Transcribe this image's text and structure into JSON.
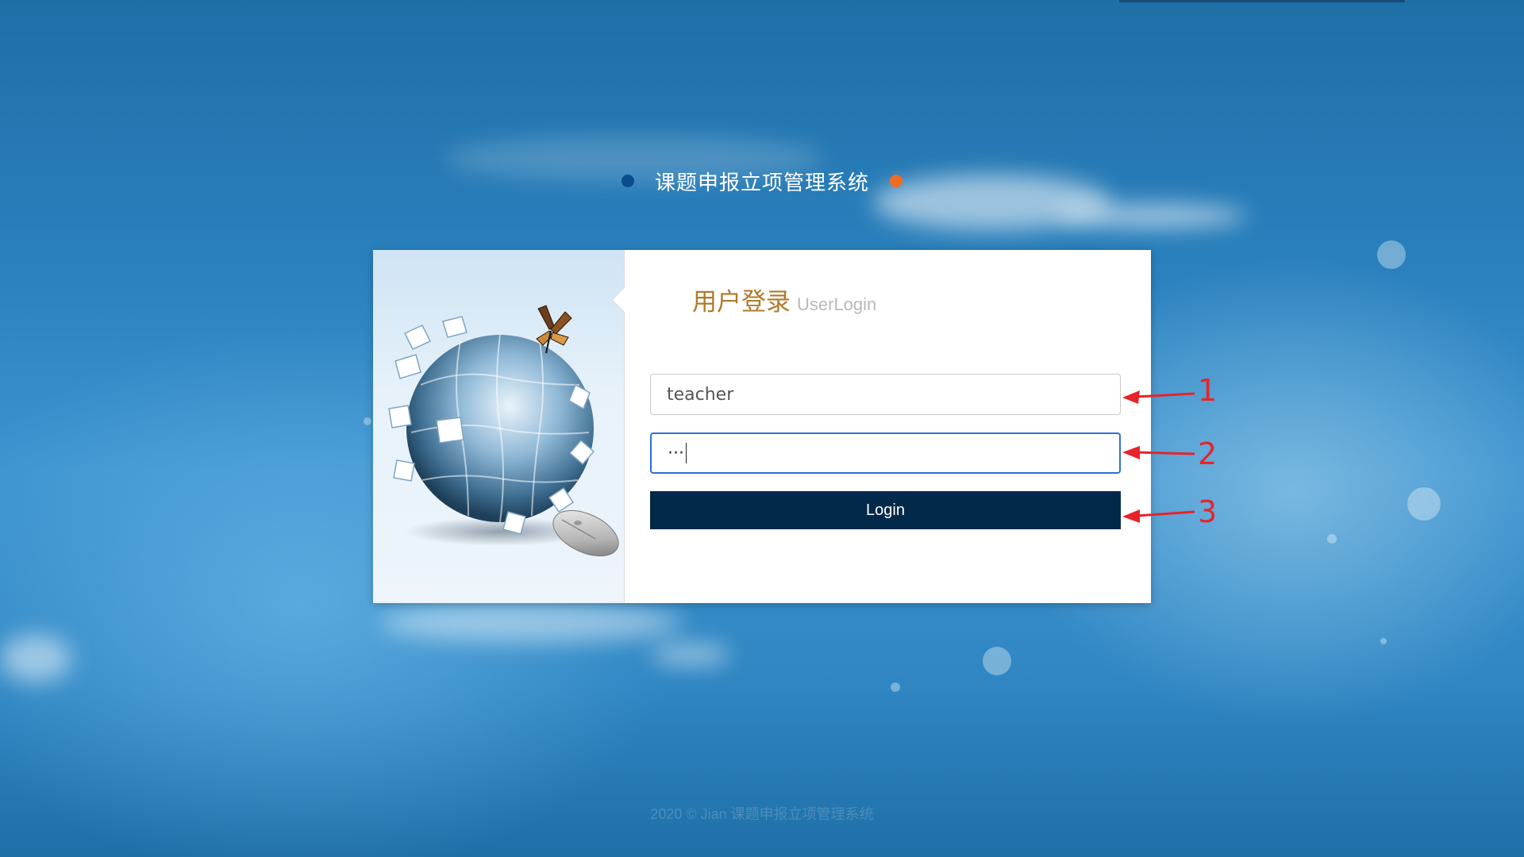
{
  "header": {
    "title": "课题申报立项管理系统"
  },
  "login_card": {
    "heading_cn": "用户登录",
    "heading_en": "UserLogin",
    "username_value": "teacher",
    "password_value": "···",
    "login_label": "Login"
  },
  "annotations": [
    "1",
    "2",
    "3"
  ],
  "footer": {
    "text": "2020 © Jian 课题申报立项管理系统"
  },
  "colors": {
    "accent_orange": "#f26b22",
    "accent_blue_dot": "#0b4d8c",
    "button_bg": "#03294a",
    "heading_gold": "#b07a2c",
    "annotation_red": "#e8232a",
    "focus_border": "#2d6fd6"
  },
  "icons": {
    "hero_illustration": "puzzle-globe-with-butterfly-and-mouse"
  }
}
